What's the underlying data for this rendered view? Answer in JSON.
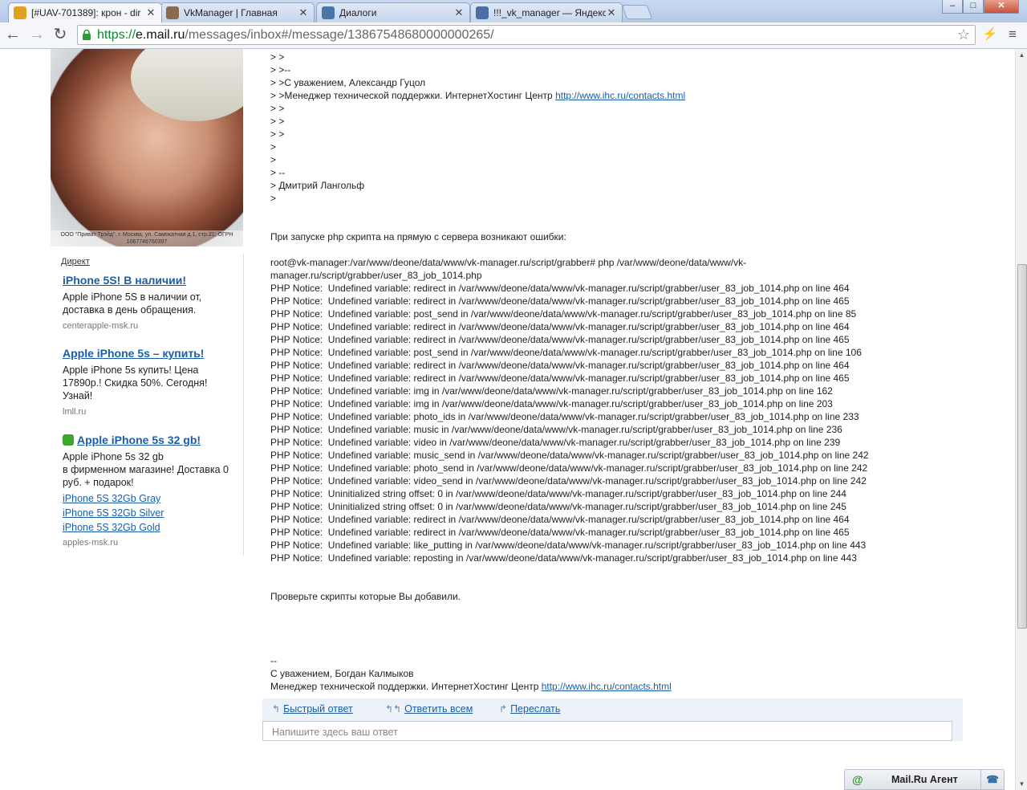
{
  "tabs": [
    {
      "title": "[#UAV-701389]: крон - dir",
      "active": true,
      "favicon_color": "#e0a020"
    },
    {
      "title": "VkManager | Главная",
      "active": false,
      "favicon_color": "#8a6b4f"
    },
    {
      "title": "Диалоги",
      "active": false,
      "favicon_color": "#4a76a8"
    },
    {
      "title": "!!!_vk_manager — Яндекс",
      "active": false,
      "favicon_color": "#4a6fa5"
    }
  ],
  "window": {
    "minimize": "–",
    "maximize": "□",
    "close": "✕"
  },
  "toolbar": {
    "back": "←",
    "forward": "→",
    "reload": "↻",
    "url_scheme": "https://",
    "url_host": "e.mail.ru",
    "url_path": "/messages/inbox#/message/13867548680000000265/",
    "star": "☆",
    "extension": "⚡",
    "menu": "≡"
  },
  "ad_image": {
    "legal_text": "ООО \"Приват Трэйд\", г. Москва, ул. Самокатная д.1, стр.21; ОГРН 1067746760397"
  },
  "ads": {
    "direct_label": "Директ",
    "items": [
      {
        "headline": "iPhone 5S! В наличии!",
        "text": "Apple iPhone 5S в наличии от, доставка в день обращения.",
        "domain": "centerapple-msk.ru"
      },
      {
        "headline": "Apple iPhone 5s – купить!",
        "text": "Apple iPhone 5s купить! Цена 17890р.! Скидка 50%. Сегодня! Узнай!",
        "domain": "lmll.ru"
      },
      {
        "headline": "Apple iPhone 5s 32 gb!",
        "text": "Apple iPhone 5s 32 gb\nв фирменном магазине! Доставка 0 руб. + подарок!",
        "links": [
          "iPhone 5S 32Gb Gray",
          "iPhone 5S 32Gb Silver",
          "iPhone 5S 32Gb Gold"
        ],
        "domain": "apples-msk.ru"
      }
    ]
  },
  "message": {
    "lines": [
      {
        "text": "> >"
      },
      {
        "text": "> >--"
      },
      {
        "text": "> >С уважением, Александр Гуцол"
      },
      {
        "text": "> >Менеджер технической поддержки. ИнтернетХостинг Центр ",
        "link": "http://www.ihc.ru/contacts.html"
      },
      {
        "text": "> >"
      },
      {
        "text": "> >"
      },
      {
        "text": "> >"
      },
      {
        "text": ">"
      },
      {
        "text": ">"
      },
      {
        "text": "> --"
      },
      {
        "text": "> Дмитрий Лангольф"
      },
      {
        "text": ">"
      },
      {
        "text": ""
      },
      {
        "text": ""
      },
      {
        "text": "При запуске php скрипта на прямую с сервера возникают ошибки:"
      },
      {
        "text": ""
      },
      {
        "text": "root@vk-manager:/var/www/deone/data/www/vk-manager.ru/script/grabber# php /var/www/deone/data/www/vk-"
      },
      {
        "text": "manager.ru/script/grabber/user_83_job_1014.php"
      },
      {
        "text": "PHP Notice:  Undefined variable: redirect in /var/www/deone/data/www/vk-manager.ru/script/grabber/user_83_job_1014.php on line 464"
      },
      {
        "text": "PHP Notice:  Undefined variable: redirect in /var/www/deone/data/www/vk-manager.ru/script/grabber/user_83_job_1014.php on line 465"
      },
      {
        "text": "PHP Notice:  Undefined variable: post_send in /var/www/deone/data/www/vk-manager.ru/script/grabber/user_83_job_1014.php on line 85"
      },
      {
        "text": "PHP Notice:  Undefined variable: redirect in /var/www/deone/data/www/vk-manager.ru/script/grabber/user_83_job_1014.php on line 464"
      },
      {
        "text": "PHP Notice:  Undefined variable: redirect in /var/www/deone/data/www/vk-manager.ru/script/grabber/user_83_job_1014.php on line 465"
      },
      {
        "text": "PHP Notice:  Undefined variable: post_send in /var/www/deone/data/www/vk-manager.ru/script/grabber/user_83_job_1014.php on line 106"
      },
      {
        "text": "PHP Notice:  Undefined variable: redirect in /var/www/deone/data/www/vk-manager.ru/script/grabber/user_83_job_1014.php on line 464"
      },
      {
        "text": "PHP Notice:  Undefined variable: redirect in /var/www/deone/data/www/vk-manager.ru/script/grabber/user_83_job_1014.php on line 465"
      },
      {
        "text": "PHP Notice:  Undefined variable: img in /var/www/deone/data/www/vk-manager.ru/script/grabber/user_83_job_1014.php on line 162"
      },
      {
        "text": "PHP Notice:  Undefined variable: img in /var/www/deone/data/www/vk-manager.ru/script/grabber/user_83_job_1014.php on line 203"
      },
      {
        "text": "PHP Notice:  Undefined variable: photo_ids in /var/www/deone/data/www/vk-manager.ru/script/grabber/user_83_job_1014.php on line 233"
      },
      {
        "text": "PHP Notice:  Undefined variable: music in /var/www/deone/data/www/vk-manager.ru/script/grabber/user_83_job_1014.php on line 236"
      },
      {
        "text": "PHP Notice:  Undefined variable: video in /var/www/deone/data/www/vk-manager.ru/script/grabber/user_83_job_1014.php on line 239"
      },
      {
        "text": "PHP Notice:  Undefined variable: music_send in /var/www/deone/data/www/vk-manager.ru/script/grabber/user_83_job_1014.php on line 242"
      },
      {
        "text": "PHP Notice:  Undefined variable: photo_send in /var/www/deone/data/www/vk-manager.ru/script/grabber/user_83_job_1014.php on line 242"
      },
      {
        "text": "PHP Notice:  Undefined variable: video_send in /var/www/deone/data/www/vk-manager.ru/script/grabber/user_83_job_1014.php on line 242"
      },
      {
        "text": "PHP Notice:  Uninitialized string offset: 0 in /var/www/deone/data/www/vk-manager.ru/script/grabber/user_83_job_1014.php on line 244"
      },
      {
        "text": "PHP Notice:  Uninitialized string offset: 0 in /var/www/deone/data/www/vk-manager.ru/script/grabber/user_83_job_1014.php on line 245"
      },
      {
        "text": "PHP Notice:  Undefined variable: redirect in /var/www/deone/data/www/vk-manager.ru/script/grabber/user_83_job_1014.php on line 464"
      },
      {
        "text": "PHP Notice:  Undefined variable: redirect in /var/www/deone/data/www/vk-manager.ru/script/grabber/user_83_job_1014.php on line 465"
      },
      {
        "text": "PHP Notice:  Undefined variable: like_putting in /var/www/deone/data/www/vk-manager.ru/script/grabber/user_83_job_1014.php on line 443"
      },
      {
        "text": "PHP Notice:  Undefined variable: reposting in /var/www/deone/data/www/vk-manager.ru/script/grabber/user_83_job_1014.php on line 443"
      },
      {
        "text": ""
      },
      {
        "text": ""
      },
      {
        "text": "Проверьте скрипты которые Вы добавили."
      },
      {
        "text": ""
      },
      {
        "text": ""
      },
      {
        "text": ""
      },
      {
        "text": ""
      },
      {
        "text": "--"
      },
      {
        "text": "С уважением, Богдан Калмыков"
      },
      {
        "text": "Менеджер технической поддержки. ИнтернетХостинг Центр ",
        "link": "http://www.ihc.ru/contacts.html"
      }
    ]
  },
  "reply": {
    "quick_reply": "Быстрый ответ",
    "reply_all": "Ответить всем",
    "forward": "Переслать",
    "placeholder": "Напишите здесь ваш ответ"
  },
  "agent": {
    "label": "Mail.Ru Агент",
    "phone_icon": "☎"
  }
}
